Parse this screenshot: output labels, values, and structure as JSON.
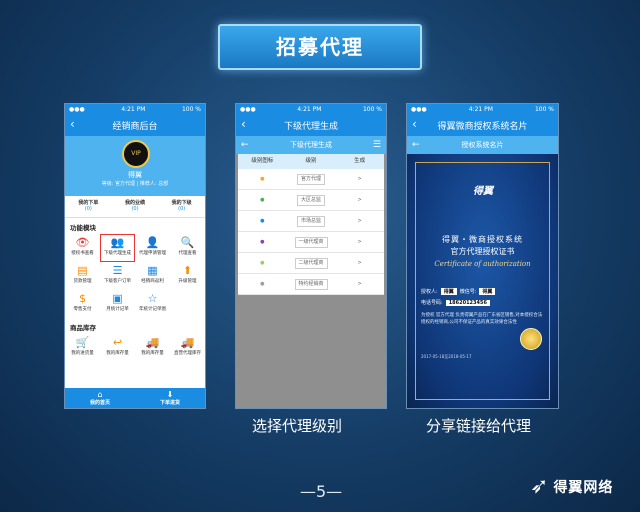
{
  "slide_title": "招募代理",
  "phones": {
    "p1": {
      "status": {
        "time": "4:21 PM",
        "battery": "100 %"
      },
      "nav_title": "经销商后台",
      "profile": {
        "name": "得翼",
        "sub": "等级: 官方代理 | 推荐人: 总部"
      },
      "stats": [
        {
          "label": "我的下单",
          "value": "(0)"
        },
        {
          "label": "我的业绩",
          "value": "(0)"
        },
        {
          "label": "我的下级",
          "value": "(0)"
        }
      ],
      "section_functions": "功能模块",
      "functions": [
        {
          "label": "授权书查看",
          "icon": "eye-icon"
        },
        {
          "label": "下级代理生成",
          "icon": "users-icon"
        },
        {
          "label": "代理申请管理",
          "icon": "user-add-icon"
        },
        {
          "label": "代理查看",
          "icon": "search-icon"
        },
        {
          "label": "货款管理",
          "icon": "money-icon"
        },
        {
          "label": "下级客户订单",
          "icon": "list-icon"
        },
        {
          "label": "经销商返利",
          "icon": "box-icon"
        },
        {
          "label": "升级管理",
          "icon": "upgrade-icon"
        },
        {
          "label": "零售支付",
          "icon": "dollar-icon"
        },
        {
          "label": "月统计记单",
          "icon": "calendar-icon"
        },
        {
          "label": "年统计记单图",
          "icon": "star-icon"
        },
        {
          "label": "",
          "icon": ""
        }
      ],
      "section_stock": "商品库存",
      "stock": [
        {
          "label": "我的进货量",
          "icon": "cart-icon"
        },
        {
          "label": "我的库存量",
          "icon": "return-icon"
        },
        {
          "label": "我的库存量",
          "icon": "car-icon"
        },
        {
          "label": "直营代理库存",
          "icon": "car-icon"
        }
      ],
      "tabs": [
        {
          "label": "我的首页",
          "icon": "home-icon"
        },
        {
          "label": "下单进货",
          "icon": "download-icon"
        }
      ]
    },
    "p2": {
      "status": {
        "time": "4:21 PM",
        "battery": "100 %"
      },
      "nav_title": "下级代理生成",
      "sub_title": "下级代理生成",
      "columns": [
        "级别图标",
        "级别",
        "生成"
      ],
      "rows": [
        {
          "color": "#f5a623",
          "level": "官方代理",
          "action": ">"
        },
        {
          "color": "#4caf50",
          "level": "大区总监",
          "action": ">"
        },
        {
          "color": "#1e88e5",
          "level": "市场总监",
          "action": ">"
        },
        {
          "color": "#8e44ad",
          "level": "一级代理商",
          "action": ">"
        },
        {
          "color": "#9ccc65",
          "level": "二级代理商",
          "action": ">"
        },
        {
          "color": "#9e9e9e",
          "level": "特约经销商",
          "action": ">"
        }
      ]
    },
    "p3": {
      "status": {
        "time": "4:21 PM",
        "battery": "100 %"
      },
      "nav_title": "得翼微商授权系统名片",
      "sub_title": "授权系统名片",
      "cert": {
        "logo": "得翼",
        "title1": "得翼・微商授权系统",
        "title2": "官方代理授权证书",
        "title3": "Certificate of authorization",
        "name_label": "授权人:",
        "name": "得翼",
        "wx_label": "微信号:",
        "wx": "得翼",
        "phone_label": "电话号码:",
        "phone": "18620123456",
        "desc": "为授权 官方代理 负责得翼产品在广东省区销售,对本授权合法授权的经销商,公司不保证产品的真实效果合法性",
        "date": "2017-05-18至2018-05-17"
      }
    }
  },
  "captions": {
    "p2": "选择代理级别",
    "p3": "分享链接给代理"
  },
  "page_number": "—5—",
  "brand_name": "得翼网络"
}
